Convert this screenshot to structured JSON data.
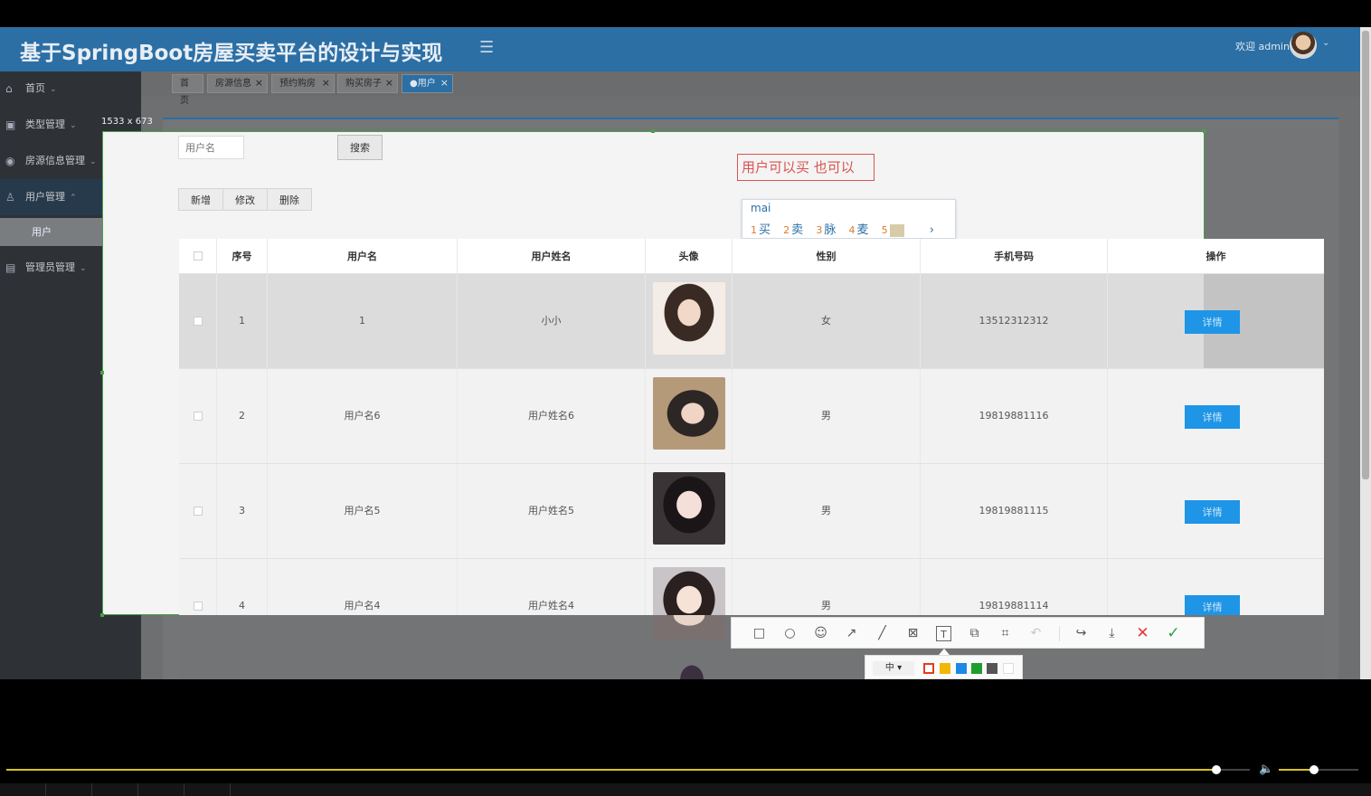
{
  "app": {
    "title": "基于SpringBoot房屋买卖平台的设计与实现",
    "welcome": "欢迎 admin",
    "header_color": "#2b6fa5"
  },
  "sidebar": {
    "items": [
      {
        "label": "首页",
        "icon": "home-icon"
      },
      {
        "label": "类型管理",
        "icon": "grid-icon"
      },
      {
        "label": "房源信息管理",
        "icon": "compass-icon"
      },
      {
        "label": "用户管理",
        "icon": "user-icon"
      },
      {
        "label": "管理员管理",
        "icon": "admin-icon"
      }
    ],
    "sub_item": "用户"
  },
  "tabs": [
    {
      "label": "首页",
      "closable": false
    },
    {
      "label": "房源信息",
      "closable": true
    },
    {
      "label": "预约购房",
      "closable": true
    },
    {
      "label": "购买房子",
      "closable": true
    },
    {
      "label": "●用户",
      "closable": true,
      "active": true
    }
  ],
  "capture": {
    "size_label": "1533 x 673"
  },
  "search": {
    "placeholder": "用户名",
    "button": "搜索"
  },
  "actions": {
    "add": "新增",
    "edit": "修改",
    "delete": "删除"
  },
  "annotation_text": "用户可以买  也可以",
  "ime": {
    "composition": "mai",
    "candidates": [
      {
        "num": "1",
        "text": "买"
      },
      {
        "num": "2",
        "text": "卖"
      },
      {
        "num": "3",
        "text": "脉"
      },
      {
        "num": "4",
        "text": "麦"
      },
      {
        "num": "5",
        "text": ""
      }
    ],
    "next": "›"
  },
  "table": {
    "headers": [
      "序号",
      "用户名",
      "用户姓名",
      "头像",
      "性别",
      "手机号码",
      "操作"
    ],
    "detail_label": "详情",
    "rows": [
      {
        "seq": "1",
        "username": "1",
        "name": "小小",
        "gender": "女",
        "phone": "13512312312"
      },
      {
        "seq": "2",
        "username": "用户名6",
        "name": "用户姓名6",
        "gender": "男",
        "phone": "19819881116"
      },
      {
        "seq": "3",
        "username": "用户名5",
        "name": "用户姓名5",
        "gender": "男",
        "phone": "19819881115"
      },
      {
        "seq": "4",
        "username": "用户名4",
        "name": "用户姓名4",
        "gender": "男",
        "phone": "19819881114"
      }
    ]
  },
  "toolbar": {
    "tools": [
      "rectangle-icon",
      "ellipse-icon",
      "emoji-icon",
      "arrow-icon",
      "pen-icon",
      "mosaic-icon",
      "text-icon",
      "pin-icon",
      "ocr-icon",
      "undo-icon",
      "share-icon",
      "save-icon",
      "cancel-icon",
      "confirm-icon"
    ],
    "font_size_label": "中",
    "colors": [
      "#e63b1e",
      "#f2b705",
      "#1e88e5",
      "#1e9e2e",
      "#555555",
      "#ffffff"
    ]
  },
  "player": {
    "progress_fraction": 0.886,
    "volume_fraction": 0.43
  }
}
